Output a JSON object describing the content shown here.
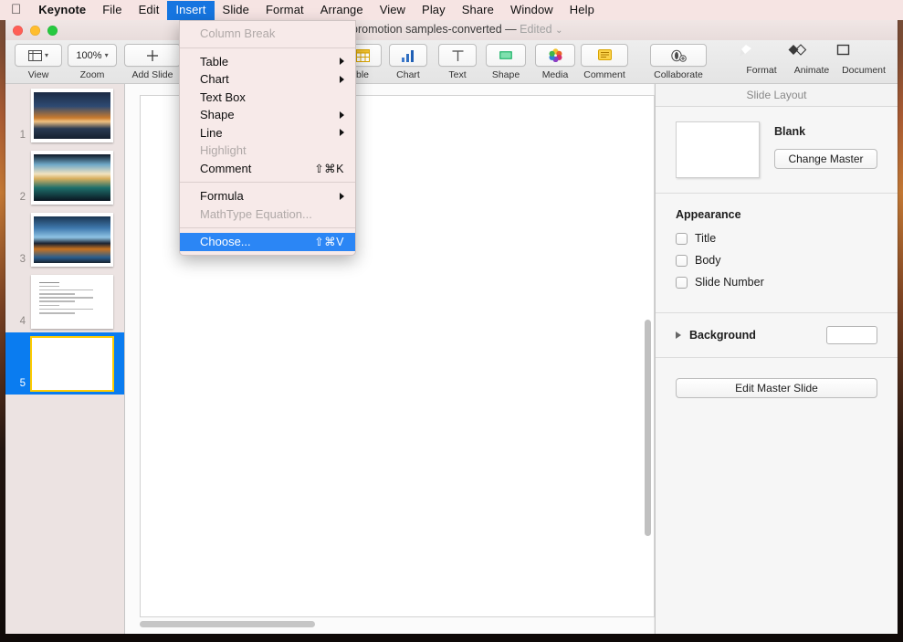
{
  "menubar": {
    "apple_icon": "apple-logo-icon",
    "items": [
      {
        "label": "Keynote",
        "bold": true,
        "active": false
      },
      {
        "label": "File",
        "bold": false,
        "active": false
      },
      {
        "label": "Edit",
        "bold": false,
        "active": false
      },
      {
        "label": "Insert",
        "bold": false,
        "active": true
      },
      {
        "label": "Slide",
        "bold": false,
        "active": false
      },
      {
        "label": "Format",
        "bold": false,
        "active": false
      },
      {
        "label": "Arrange",
        "bold": false,
        "active": false
      },
      {
        "label": "View",
        "bold": false,
        "active": false
      },
      {
        "label": "Play",
        "bold": false,
        "active": false
      },
      {
        "label": "Share",
        "bold": false,
        "active": false
      },
      {
        "label": "Window",
        "bold": false,
        "active": false
      },
      {
        "label": "Help",
        "bold": false,
        "active": false
      }
    ]
  },
  "titlebar": {
    "document_name": "w promotion samples-converted",
    "separator": "—",
    "edited_status": "Edited",
    "chevron": "⌄"
  },
  "toolbar": {
    "view_label": "View",
    "zoom_label": "Zoom",
    "zoom_value": "100%",
    "add_slide_label": "Add Slide",
    "table_label": "ble",
    "chart_label": "Chart",
    "text_label": "Text",
    "shape_label": "Shape",
    "media_label": "Media",
    "comment_label": "Comment",
    "collaborate_label": "Collaborate",
    "format_label": "Format",
    "animate_label": "Animate",
    "document_label": "Document"
  },
  "sidebar": {
    "slides": [
      {
        "number": "1",
        "kind": "image",
        "style": "p1",
        "selected": false
      },
      {
        "number": "2",
        "kind": "image",
        "style": "p2",
        "selected": false
      },
      {
        "number": "3",
        "kind": "image",
        "style": "p3",
        "selected": false
      },
      {
        "number": "4",
        "kind": "document",
        "style": "",
        "selected": false
      },
      {
        "number": "5",
        "kind": "blank",
        "style": "",
        "selected": true
      }
    ]
  },
  "inspector": {
    "panel_title": "Slide Layout",
    "master_name": "Blank",
    "change_master_label": "Change Master",
    "appearance_heading": "Appearance",
    "checkboxes": [
      {
        "label": "Title",
        "checked": false
      },
      {
        "label": "Body",
        "checked": false
      },
      {
        "label": "Slide Number",
        "checked": false
      }
    ],
    "background_label": "Background",
    "background_color": "#ffffff",
    "edit_master_label": "Edit Master Slide"
  },
  "insert_menu": {
    "items": [
      {
        "label": "Column Break",
        "shortcut": "",
        "submenu": false,
        "disabled": true,
        "highlighted": false,
        "separator_after": true
      },
      {
        "label": "Table",
        "shortcut": "",
        "submenu": true,
        "disabled": false,
        "highlighted": false,
        "separator_after": false
      },
      {
        "label": "Chart",
        "shortcut": "",
        "submenu": true,
        "disabled": false,
        "highlighted": false,
        "separator_after": false
      },
      {
        "label": "Text Box",
        "shortcut": "",
        "submenu": false,
        "disabled": false,
        "highlighted": false,
        "separator_after": false
      },
      {
        "label": "Shape",
        "shortcut": "",
        "submenu": true,
        "disabled": false,
        "highlighted": false,
        "separator_after": false
      },
      {
        "label": "Line",
        "shortcut": "",
        "submenu": true,
        "disabled": false,
        "highlighted": false,
        "separator_after": false
      },
      {
        "label": "Highlight",
        "shortcut": "",
        "submenu": false,
        "disabled": true,
        "highlighted": false,
        "separator_after": false
      },
      {
        "label": "Comment",
        "shortcut": "⇧⌘K",
        "submenu": false,
        "disabled": false,
        "highlighted": false,
        "separator_after": true
      },
      {
        "label": "Formula",
        "shortcut": "",
        "submenu": true,
        "disabled": false,
        "highlighted": false,
        "separator_after": false
      },
      {
        "label": "MathType Equation...",
        "shortcut": "",
        "submenu": false,
        "disabled": true,
        "highlighted": false,
        "separator_after": true
      },
      {
        "label": "Choose...",
        "shortcut": "⇧⌘V",
        "submenu": false,
        "disabled": false,
        "highlighted": true,
        "separator_after": false
      }
    ]
  },
  "colors": {
    "menubar_bg": "#f6e4e3",
    "menu_highlight": "#2b86f5",
    "slide_selected": "#0a7cf0",
    "slide_selected_border": "#ffcc00",
    "accent_active_toolbar": "#5f5f5f"
  }
}
